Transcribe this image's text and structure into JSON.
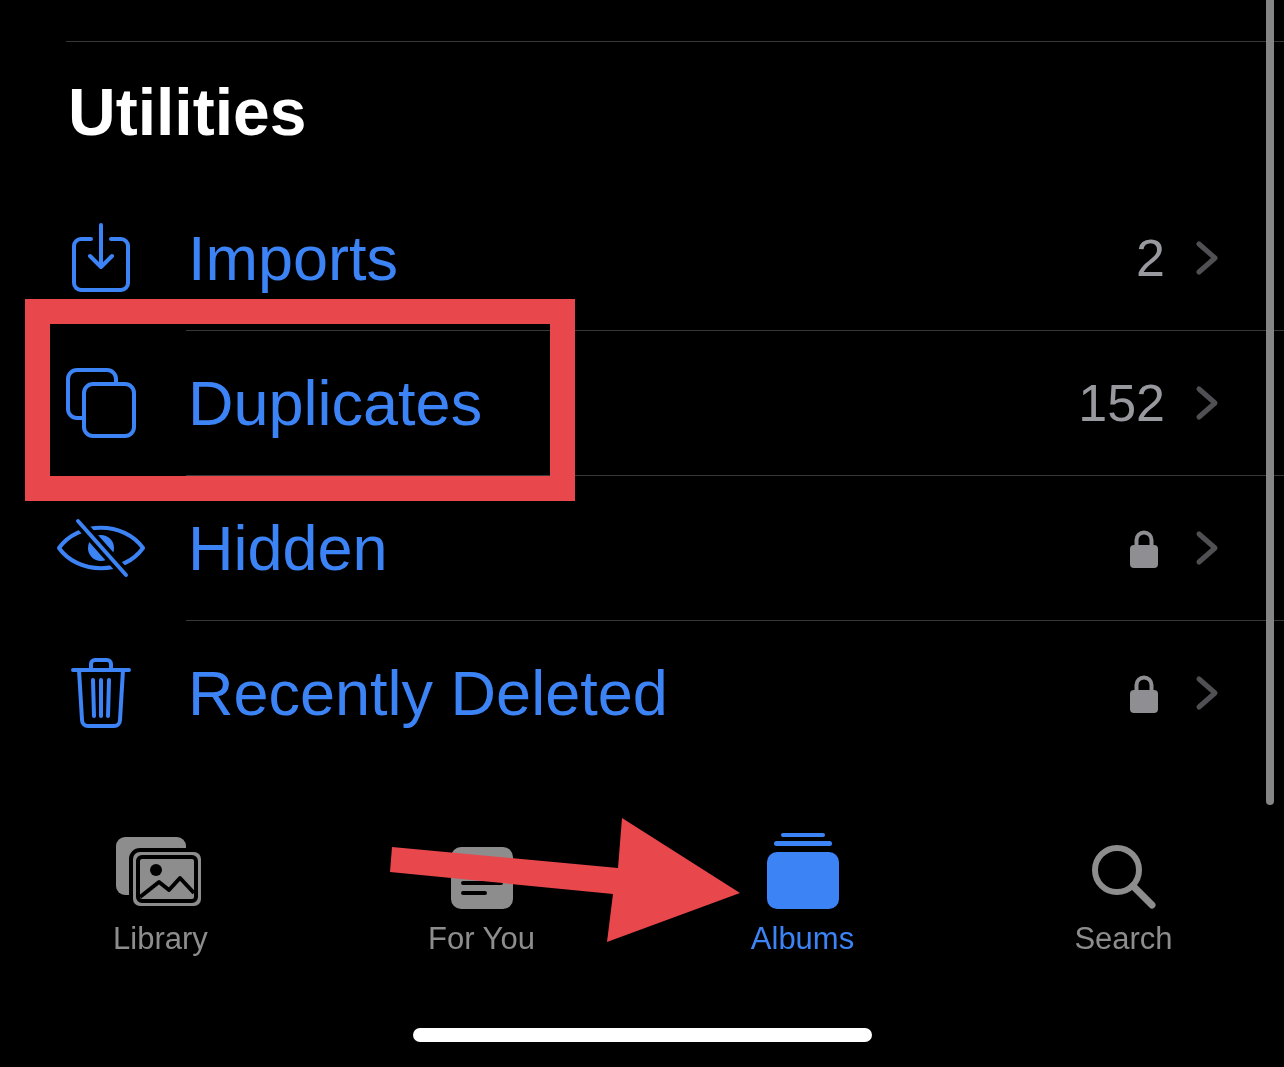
{
  "section": {
    "title": "Utilities"
  },
  "rows": [
    {
      "kind": "imports",
      "label": "Imports",
      "count": "2",
      "locked": false,
      "highlighted": false
    },
    {
      "kind": "duplicates",
      "label": "Duplicates",
      "count": "152",
      "locked": false,
      "highlighted": true
    },
    {
      "kind": "hidden",
      "label": "Hidden",
      "locked": true,
      "highlighted": false
    },
    {
      "kind": "deleted",
      "label": "Recently Deleted",
      "locked": true,
      "highlighted": false
    }
  ],
  "tab_bar": {
    "pointer_arrow": true,
    "tabs": [
      {
        "kind": "library",
        "label": "Library",
        "selected": false
      },
      {
        "kind": "for_you",
        "label": "For You",
        "selected": false
      },
      {
        "kind": "albums",
        "label": "Albums",
        "selected": true
      },
      {
        "kind": "search",
        "label": "Search",
        "selected": false
      }
    ]
  }
}
